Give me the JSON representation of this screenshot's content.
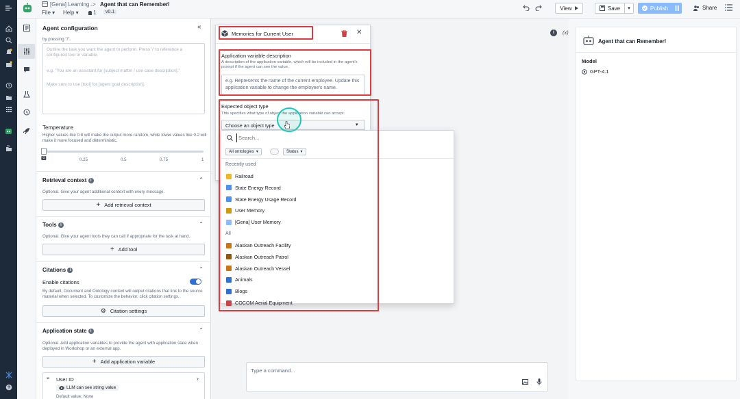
{
  "topbar": {
    "breadcrumb_folder": "[Gena] Learning...",
    "separator": ">",
    "title": "Agent that can Remember!",
    "menu_file": "File",
    "menu_help": "Help",
    "members_count": "1",
    "version": "v0.1",
    "view_label": "View",
    "save_label": "Save",
    "publish_label": "Publish",
    "share_label": "Share"
  },
  "config": {
    "title": "Agent configuration",
    "prompt_hint_top": "by pressing \"/\".",
    "prompt_placeholder_1": "Outline the task you want the agent to perform. Press '/' to reference a configured tool or variable.",
    "prompt_placeholder_2": "e.g. \"You are an assistant for [subject matter / use case description].\"",
    "prompt_placeholder_3": "Make sure to use [tool] for [agent goal description].",
    "temperature_title": "Temperature",
    "temperature_desc": "Higher values like 0.8 will make the output more random, while lower values like 0.2 will make it more focused and deterministic.",
    "temperature_value": 0,
    "temperature_value_label": "0",
    "temperature_ticks": [
      "0.25",
      "0.5",
      "0.75",
      "1"
    ],
    "retrieval_title": "Retrieval context",
    "retrieval_desc": "Optional. Give your agent additional context with every message.",
    "retrieval_button": "Add retrieval context",
    "tools_title": "Tools",
    "tools_desc": "Optional. Give your agent tools they can call if appropriate for the task at hand.",
    "tools_button": "Add tool",
    "citations_title": "Citations",
    "citations_enable_label": "Enable citations",
    "citations_enabled": true,
    "citations_desc": "By default, Document and Ontology context will output citations that link to the source material when selected. To customize the behavior, click citation settings.",
    "citations_button": "Citation settings",
    "appstate_title": "Application state",
    "appstate_desc": "Optional. Add application variables to provide the agent with application state when deployed in Workshop or an external app.",
    "appstate_button": "Add application variable",
    "variable_name": "User ID",
    "variable_badge": "LLM can see string value",
    "variable_default_label": "Default value:",
    "variable_default_value": "None"
  },
  "modal": {
    "title": "Memories for Current User",
    "desc_title": "Application variable description",
    "desc_help": "A description of the application variable, which will be included in the agent's prompt if the agent can see the value.",
    "desc_placeholder": "e.g. Represents the name of the current employee. Update this application variable to change the employee's name.",
    "type_title": "Expected object type",
    "type_help": "This specifies what type of object the application variable can accept.",
    "type_placeholder": "Choose an object type"
  },
  "dropdown": {
    "search_placeholder": "Search...",
    "filter_ontologies": "All ontologies",
    "filter_status": "Status",
    "recent_header": "Recently used",
    "recent": [
      {
        "label": "Railroad",
        "icon": "railroad-icon",
        "color": "#f0b726"
      },
      {
        "label": "State Energy Record",
        "icon": "record-icon",
        "color": "#4c90f0"
      },
      {
        "label": "State Energy Usage Record",
        "icon": "record-icon",
        "color": "#4c90f0"
      },
      {
        "label": "User Memory",
        "icon": "memory-icon",
        "color": "#d1980b"
      },
      {
        "label": "[Gena] User Memory",
        "icon": "memory-icon",
        "color": "#8abbff"
      }
    ],
    "all_header": "All",
    "all": [
      {
        "label": "Alaskan Outreach Facility",
        "icon": "facility-icon",
        "color": "#c87619"
      },
      {
        "label": "Alaskan Outreach Patrol",
        "icon": "patrol-icon",
        "color": "#935610"
      },
      {
        "label": "Alaskan Outreach Vessel",
        "icon": "vessel-icon",
        "color": "#c87619"
      },
      {
        "label": "Animals",
        "icon": "globe-icon",
        "color": "#2d72d2"
      },
      {
        "label": "Blogs",
        "icon": "document-icon",
        "color": "#2d72d2"
      },
      {
        "label": "COCOM Aerial Equipment",
        "icon": "equipment-icon",
        "color": "#cd4246"
      }
    ]
  },
  "preview": {
    "agent_name": "Agent that can Remember!",
    "model_label": "Model",
    "model_value": "GPT-4.1",
    "variable_toggle": "(x)",
    "command_placeholder": "Type a command..."
  },
  "colors": {
    "accent": "#2d72d2",
    "highlight_red": "#e0393e",
    "nav_bg": "#1d2a3a",
    "agent_green": "#32a467",
    "cursor_ring": "#1ec8b4"
  }
}
